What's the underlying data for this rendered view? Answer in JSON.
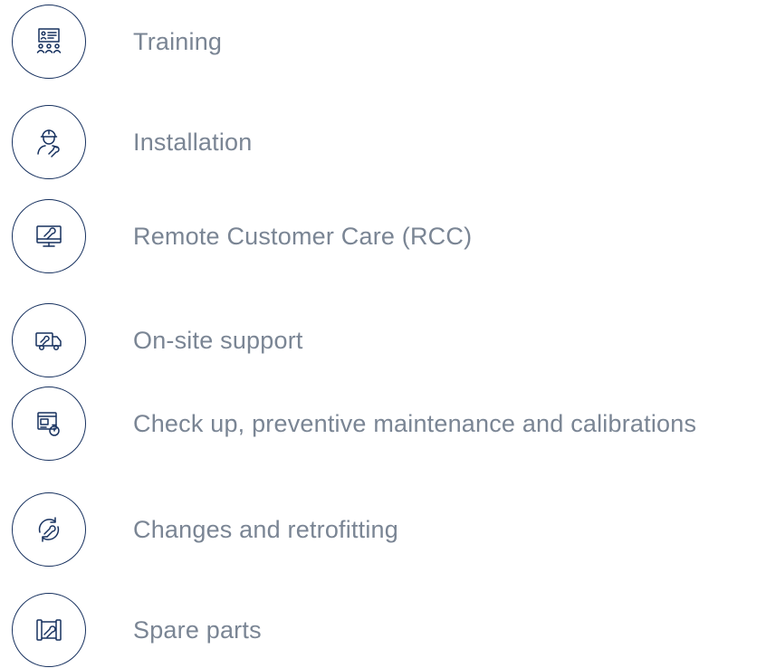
{
  "colors": {
    "icon": "#17315f",
    "label": "#7a8594",
    "background": "#ffffff"
  },
  "services": [
    {
      "label": "Training",
      "icon": "training-presentation-icon"
    },
    {
      "label": "Installation",
      "icon": "technician-with-wrench-icon"
    },
    {
      "label": "Remote Customer Care (RCC)",
      "icon": "monitor-wrench-icon"
    },
    {
      "label": "On-site support",
      "icon": "service-truck-icon"
    },
    {
      "label": "Check up, preventive maintenance and calibrations",
      "icon": "window-stopwatch-icon"
    },
    {
      "label": "Changes and retrofitting",
      "icon": "circular-arrows-wrench-icon"
    },
    {
      "label": "Spare parts",
      "icon": "blueprint-wrench-icon"
    }
  ]
}
